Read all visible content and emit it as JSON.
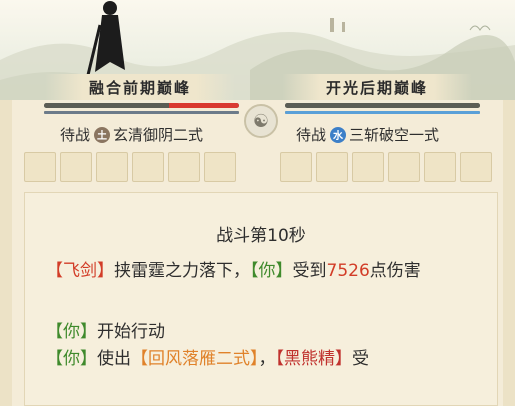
{
  "player": {
    "realm": "融合前期巅峰",
    "status_label": "待战",
    "element": "土",
    "element_color": "#8a7560",
    "technique": "玄清御阴二式",
    "hp_fraction": 0.82,
    "hp_color": "#d93a32"
  },
  "enemy": {
    "realm": "开光后期巅峰",
    "status_label": "待战",
    "element": "水",
    "element_color": "#3c7fc8",
    "technique": "三斩破空一式",
    "hp_fraction": 1.0,
    "mp_color": "#5aa0d8"
  },
  "center_emblem": "☯",
  "battle": {
    "title": "战斗第10秒",
    "log": [
      {
        "parts": [
          {
            "t": "【飞剑】",
            "c": "red"
          },
          {
            "t": "挟雷霆之力落下，",
            "c": ""
          },
          {
            "t": "【你】",
            "c": "green"
          },
          {
            "t": "受到",
            "c": ""
          },
          {
            "t": "7526",
            "c": "red"
          },
          {
            "t": "点伤害",
            "c": ""
          }
        ]
      },
      {
        "parts": [
          {
            "t": "【你】",
            "c": "green"
          },
          {
            "t": "开始行动",
            "c": ""
          }
        ]
      },
      {
        "parts": [
          {
            "t": "【你】",
            "c": "green"
          },
          {
            "t": "使出",
            "c": ""
          },
          {
            "t": "【回风落雁二式】",
            "c": "orange"
          },
          {
            "t": "，",
            "c": ""
          },
          {
            "t": "【黑熊精】",
            "c": "crimson"
          },
          {
            "t": "受",
            "c": ""
          }
        ]
      }
    ]
  }
}
